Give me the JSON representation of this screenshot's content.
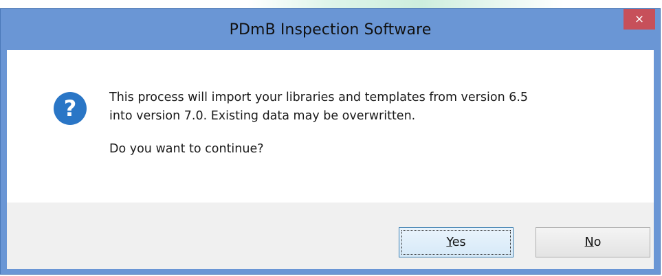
{
  "dialog": {
    "title": "PDmB Inspection Software",
    "close_label": "×",
    "icon": "question-icon",
    "message_line1": "This process will import your libraries and templates from version 6.5",
    "message_line2": "into version 7.0. Existing data may be overwritten.",
    "question": "Do you want to continue?",
    "buttons": {
      "yes_mnemonic": "Y",
      "yes_rest": "es",
      "no_mnemonic": "N",
      "no_rest": "o"
    }
  },
  "colors": {
    "titlebar": "#6a96d5",
    "close_button": "#c7505a",
    "icon_blue": "#2a76c6",
    "footer": "#f0f0f0"
  }
}
